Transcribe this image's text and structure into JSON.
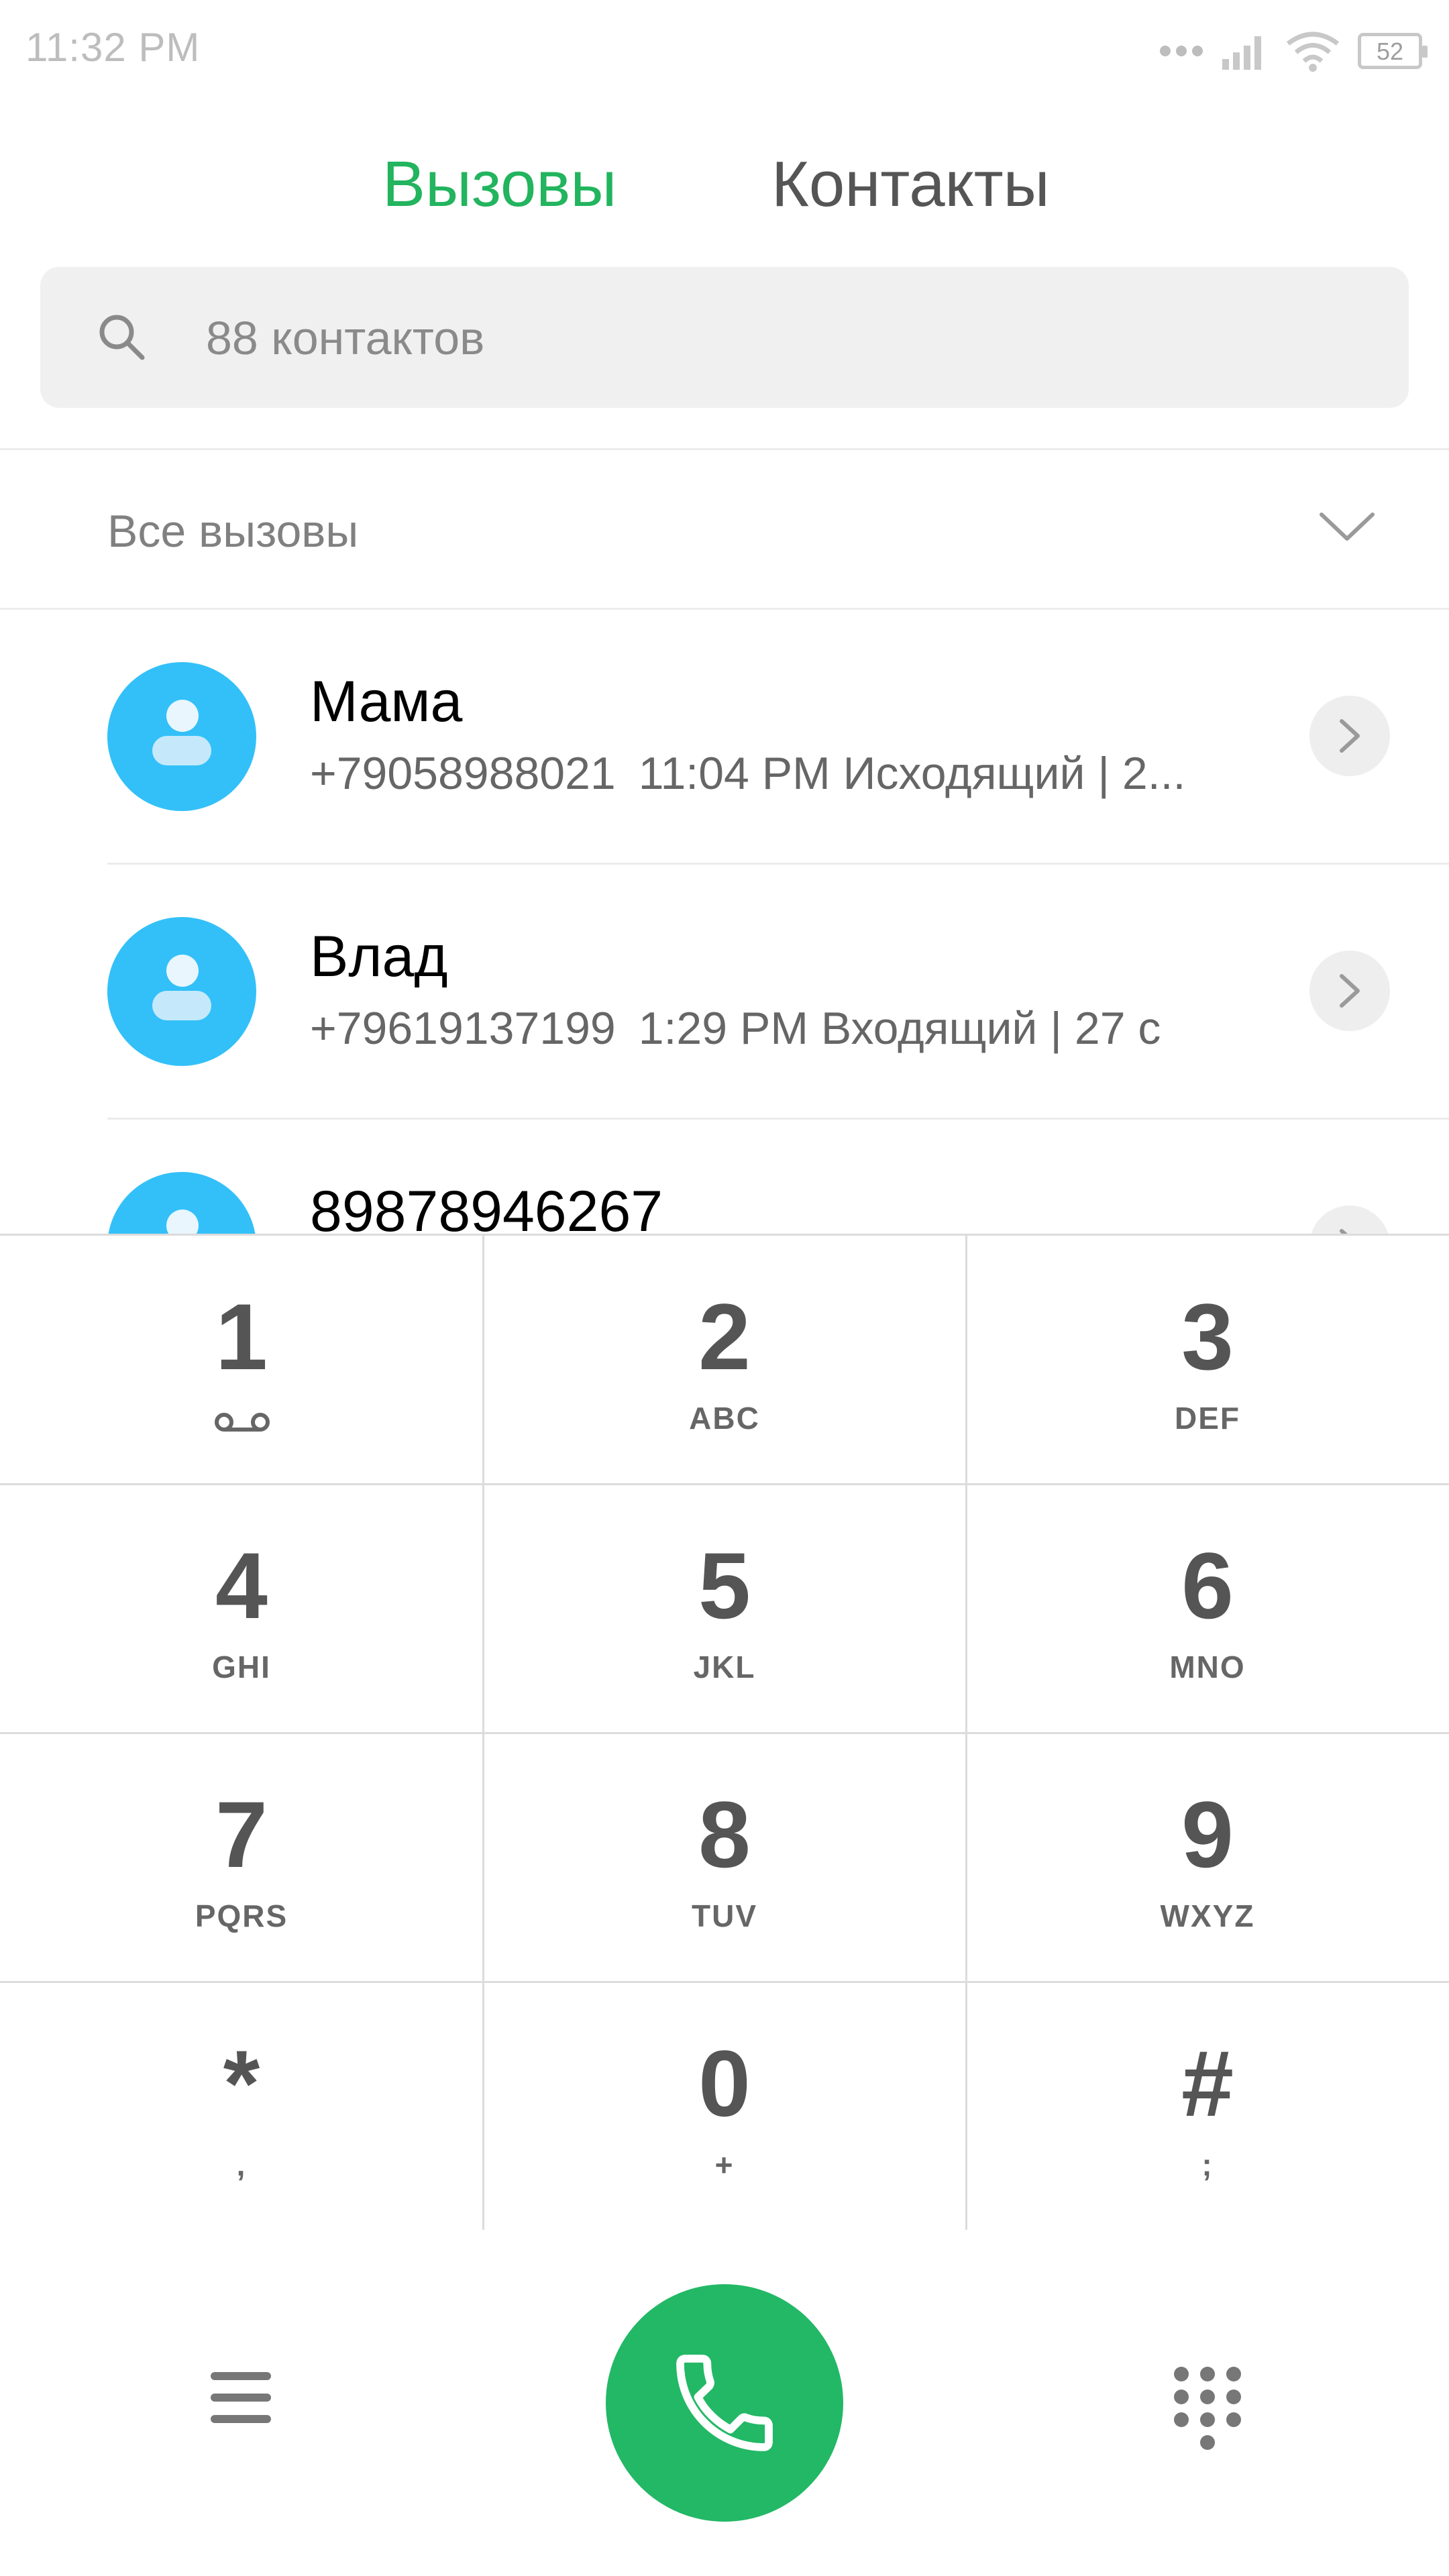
{
  "status_bar": {
    "time": "11:32 PM",
    "battery_level": "52",
    "icons": [
      "dots-icon",
      "signal-icon",
      "wifi-icon",
      "battery-icon"
    ]
  },
  "tabs": [
    {
      "label": "Вызовы",
      "active": true
    },
    {
      "label": "Контакты",
      "active": false
    }
  ],
  "search": {
    "placeholder": "88 контактов"
  },
  "filter": {
    "label": "Все вызовы"
  },
  "calls": [
    {
      "name": "Мама",
      "number": "+79058988021",
      "detail": "11:04 PM Исходящий | 2..."
    },
    {
      "name": "Влад",
      "number": "+79619137199",
      "detail": "1:29 PM Входящий | 27 с"
    },
    {
      "name": "89878946267",
      "number": "",
      "detail": ""
    }
  ],
  "dialpad": [
    {
      "digit": "1",
      "letters": ""
    },
    {
      "digit": "2",
      "letters": "ABC"
    },
    {
      "digit": "3",
      "letters": "DEF"
    },
    {
      "digit": "4",
      "letters": "GHI"
    },
    {
      "digit": "5",
      "letters": "JKL"
    },
    {
      "digit": "6",
      "letters": "MNO"
    },
    {
      "digit": "7",
      "letters": "PQRS"
    },
    {
      "digit": "8",
      "letters": "TUV"
    },
    {
      "digit": "9",
      "letters": "WXYZ"
    },
    {
      "digit": "*",
      "letters": ","
    },
    {
      "digit": "0",
      "letters": "+"
    },
    {
      "digit": "#",
      "letters": ";"
    }
  ],
  "colors": {
    "accent": "#22b45e",
    "avatar": "#33c0f8",
    "call_button": "#22b866"
  }
}
